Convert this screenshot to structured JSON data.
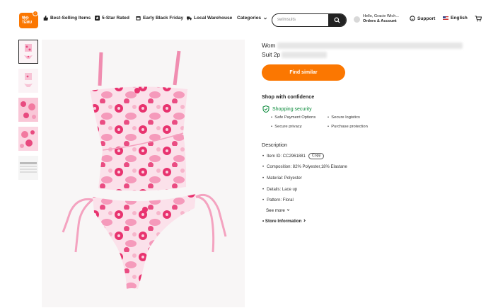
{
  "header": {
    "logo_text": "TEMU",
    "logo_top": "特价",
    "nav": [
      {
        "label": "Best-Selling Items",
        "icon": "thumbs-up-icon"
      },
      {
        "label": "5-Star Rated",
        "icon": "star-icon"
      },
      {
        "label": "Early Black Friday",
        "icon": "calendar-icon"
      },
      {
        "label": "Local Warehouse",
        "icon": "truck-icon"
      },
      {
        "label": "Categories",
        "icon": "chevron-down-icon"
      }
    ],
    "search": {
      "value": "swimsuits"
    },
    "account": {
      "greeting": "Hello, Gracie Wich...",
      "label": "Orders & Account"
    },
    "support_label": "Support",
    "language_label": "English"
  },
  "product": {
    "title_line1": "Wom",
    "title_line2": "Suit 2p",
    "find_similar_label": "Find similar",
    "shop_confidence_title": "Shop with confidence",
    "security_label": "Shopping security",
    "features": [
      "Safe Payment Options",
      "Secure logistics",
      "Secure privacy",
      "Purchase protection"
    ],
    "description_title": "Description",
    "item_id": "Item ID: CC2961881",
    "copy_label": "Copy",
    "details": [
      "Composition: 82% Polyester,18% Elastane",
      "Material: Polyester",
      "Details: Lace up",
      "Pattern: Floral"
    ],
    "see_more_label": "See more",
    "store_info_label": "Store Information"
  },
  "colors": {
    "accent": "#fb7701",
    "secure": "#0a8a3a",
    "pink": "#f06a9a",
    "pink_light": "#fbd0df"
  }
}
